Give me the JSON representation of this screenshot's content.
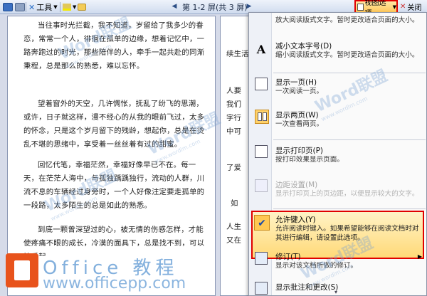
{
  "toolbar": {
    "tools_label": "工具",
    "pages_label": "第 1-2 屏(共 3 屏)",
    "view_options_label": "视图选项",
    "close_label": "关闭"
  },
  "document": {
    "left_paragraphs": [
      "当往事时光拦截，我不知道，岁留给了我多少的眷恋，常常一个人，徘徊在孤单的边缘，想着记忆中，一路奔跑过的时光，那些陪伴的人，牵手一起共赴的同渐秉程，总是那么的熟悉，难以忘怀。",
      "望着窗外的天空，几许惆怅，抚乱了纷飞的思潮，或许，日子就这样，漫不经心的从我的眼前飞过，太多的怀念，只是这个岁月留下的残龄，想起你，总是在烫乱不堪的思绪中，享受着一丝丝着有过的甜蜜。",
      "回忆代笔，幸福茫然，幸福好像早已不在。每一天，在茫茫人海中，与孤独踽踽独行，流动的人群，川流不息的车辆经过身旁时，一个人好像注定要走孤单的一段路，太多陌生的总是如此的熟悉。",
      "到底一颗曾深望过的心，被无情的伤感怎样，才能使疼痛不眼的成长，冷漠的面具下，总是找不到，可以快乐起"
    ],
    "right_fragments": [
      "续生活",
      "",
      "人要",
      "我们",
      "字行",
      "中可",
      "",
      "了爱",
      "",
      "如",
      "",
      "人生",
      "又在"
    ]
  },
  "menu": {
    "items": [
      {
        "title": "",
        "desc": "放大阅读版式文字。暂时更改适合页面的大小。"
      },
      {
        "title": "减小文本字号(D)",
        "desc": "缩小阅读版式文字。暂时更改适合页面的大小。"
      },
      {
        "title": "显示一页(H)",
        "desc": "一次阅读一页。"
      },
      {
        "title": "显示两页(W)",
        "desc": "一次查看两页。"
      },
      {
        "title": "显示打印页(P)",
        "desc": "按打印效果显示页面。"
      },
      {
        "title": "边距设置(M)",
        "desc": "显示打印页上的页边距，以便显示较大的文字。"
      },
      {
        "title": "允许键入(Y)",
        "desc": "允许阅读时键入。如果希望能够在阅读文档时对其进行编辑，请设置此选项。"
      },
      {
        "title": "修订(T)",
        "desc": "显示对该文档所做的修订。"
      },
      {
        "title": "显示批注和更改(S)",
        "desc": ""
      }
    ]
  },
  "watermark": {
    "brand": "Word联盟",
    "url": "www.wordlm.com",
    "logo_text": "Office 教程",
    "logo_url": "www.officepp.com"
  }
}
